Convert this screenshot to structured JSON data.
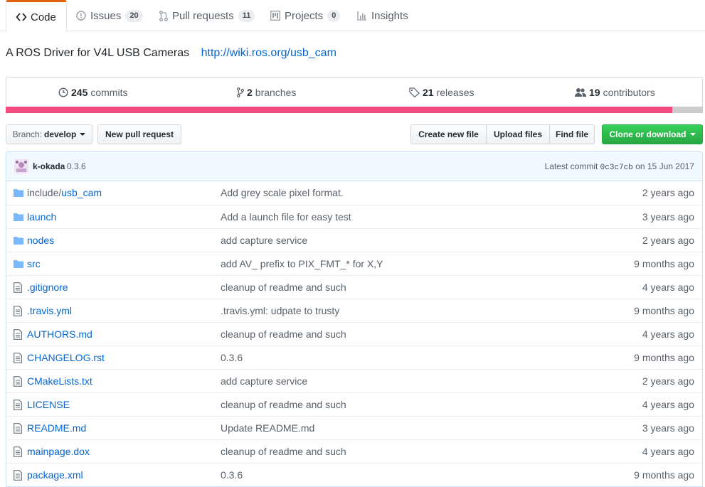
{
  "tabs": [
    {
      "label": "Code",
      "icon": "code-icon"
    },
    {
      "label": "Issues",
      "count": "20",
      "icon": "issue-icon"
    },
    {
      "label": "Pull requests",
      "count": "11",
      "icon": "pull-request-icon"
    },
    {
      "label": "Projects",
      "count": "0",
      "icon": "project-icon"
    },
    {
      "label": "Insights",
      "icon": "graph-icon"
    }
  ],
  "description": {
    "text": "A ROS Driver for V4L USB Cameras",
    "link": "http://wiki.ros.org/usb_cam"
  },
  "summary": {
    "commits_count": "245",
    "commits_label": "commits",
    "branches_count": "2",
    "branches_label": "branches",
    "releases_count": "21",
    "releases_label": "releases",
    "contributors_count": "19",
    "contributors_label": "contributors"
  },
  "language_bar": {
    "primary_color": "#f34b7d",
    "rest_color": "#cccccc",
    "primary_fraction": 0.956
  },
  "toolbar": {
    "branch_label": "Branch:",
    "branch_value": "develop",
    "new_pull_request": "New pull request",
    "create_new_file": "Create new file",
    "upload_files": "Upload files",
    "find_file": "Find file",
    "clone_or_download": "Clone or download",
    "green": "#28a745"
  },
  "commit": {
    "author": "k-okada",
    "message": "0.3.6",
    "latest_prefix": "Latest commit",
    "sha": "0c3c7cb",
    "date_prefix": "on",
    "date": "15 Jun 2017"
  },
  "files": [
    {
      "type": "folder",
      "name_prefix": "include/",
      "name": "usb_cam",
      "message": "Add grey scale pixel format.",
      "age": "2 years ago"
    },
    {
      "type": "folder",
      "name_prefix": "",
      "name": "launch",
      "message": "Add a launch file for easy test",
      "age": "3 years ago"
    },
    {
      "type": "folder",
      "name_prefix": "",
      "name": "nodes",
      "message": "add capture service",
      "age": "2 years ago"
    },
    {
      "type": "folder",
      "name_prefix": "",
      "name": "src",
      "message": "add AV_ prefix to PIX_FMT_* for X,Y",
      "age": "9 months ago"
    },
    {
      "type": "file",
      "name_prefix": "",
      "name": ".gitignore",
      "message": "cleanup of readme and such",
      "age": "4 years ago"
    },
    {
      "type": "file",
      "name_prefix": "",
      "name": ".travis.yml",
      "message": ".travis.yml: udpate to trusty",
      "age": "9 months ago"
    },
    {
      "type": "file",
      "name_prefix": "",
      "name": "AUTHORS.md",
      "message": "cleanup of readme and such",
      "age": "4 years ago"
    },
    {
      "type": "file",
      "name_prefix": "",
      "name": "CHANGELOG.rst",
      "message": "0.3.6",
      "age": "9 months ago"
    },
    {
      "type": "file",
      "name_prefix": "",
      "name": "CMakeLists.txt",
      "message": "add capture service",
      "age": "2 years ago"
    },
    {
      "type": "file",
      "name_prefix": "",
      "name": "LICENSE",
      "message": "cleanup of readme and such",
      "age": "4 years ago"
    },
    {
      "type": "file",
      "name_prefix": "",
      "name": "README.md",
      "message": "Update README.md",
      "age": "3 years ago"
    },
    {
      "type": "file",
      "name_prefix": "",
      "name": "mainpage.dox",
      "message": "cleanup of readme and such",
      "age": "4 years ago"
    },
    {
      "type": "file",
      "name_prefix": "",
      "name": "package.xml",
      "message": "0.3.6",
      "age": "9 months ago"
    }
  ]
}
